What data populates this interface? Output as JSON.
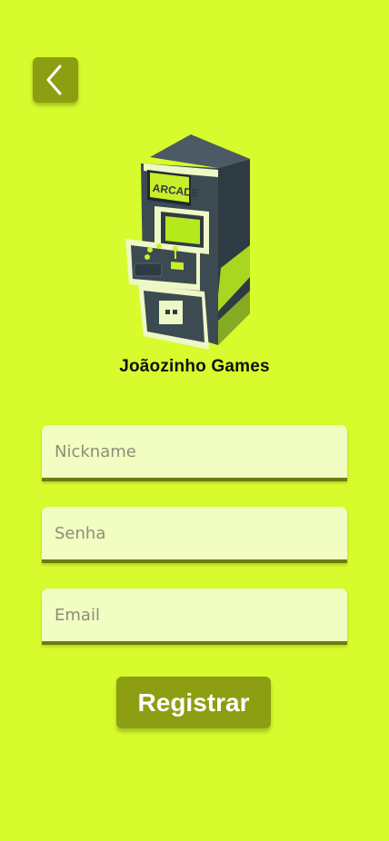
{
  "header": {
    "back_icon": "chevron-left-icon"
  },
  "logo": {
    "sign_text": "ARCADE",
    "icon": "arcade-machine-icon"
  },
  "app": {
    "title": "Joãozinho Games"
  },
  "form": {
    "nickname_placeholder": "Nickname",
    "password_placeholder": "Senha",
    "email_placeholder": "Email",
    "submit_label": "Registrar"
  },
  "colors": {
    "background": "#d7fb2c",
    "accent": "#8c9f12",
    "field_bg": "#f1fdc1",
    "field_border": "#6c7b0e",
    "machine_body": "#3c4a52"
  }
}
